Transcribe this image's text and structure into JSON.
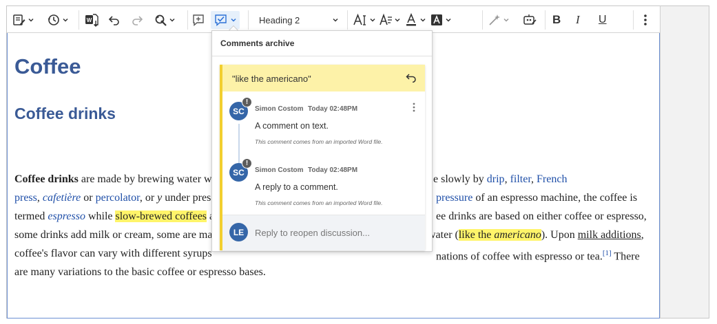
{
  "toolbar": {
    "heading_select": "Heading 2",
    "bold": "B",
    "italic": "I",
    "underline": "U"
  },
  "document": {
    "title": "Coffee",
    "subtitle": "Coffee drinks",
    "lines": {
      "l1_bold": "Coffee drinks",
      "l1_a": " are made by brewing water w",
      "l1_b": "e slowly by ",
      "l1_link1": "drip",
      "l1_c": ", ",
      "l1_link2": "filter",
      "l1_d": ", ",
      "l1_link3": "French",
      "l2_link1": "press",
      "l2_a": ", ",
      "l2_link2": "cafetière",
      "l2_b": " or ",
      "l2_link3": "percolator",
      "l2_c": ", or ",
      "l2_y": "y",
      "l2_d": " under pres",
      "l2_link4": "pressure",
      "l2_e": " of an espresso machine, the coffee is",
      "l3_a": "termed ",
      "l3_link1": "espresso",
      "l3_b": " while ",
      "l3_hl": "slow-brewed coffees",
      "l3_c": " a",
      "l3_d": "ee drinks are based on either coffee or espresso,",
      "l4_a": "some drinks add milk or cream, some are ma",
      "l4_b": "water (",
      "l4_hl1": "like the ",
      "l4_hl2": "americano",
      "l4_c": "). Upon ",
      "l4_ul": "milk additions",
      "l4_d": ",",
      "l5_a": "coffee's flavor can vary with different syrups",
      "l5_b": "nations of coffee with espresso or tea.",
      "l5_sup": "[1]",
      "l5_c": " There",
      "l6_a": "are many variations to the basic coffee or espresso bases."
    }
  },
  "comments_archive": {
    "header": "Comments archive",
    "quote": "\"like the americano\"",
    "comments": [
      {
        "initials": "SC",
        "badge": "!",
        "author": "Simon Costom",
        "time": "Today 02:48PM",
        "text": "A comment on text.",
        "note": "This comment comes from an imported Word file."
      },
      {
        "initials": "SC",
        "badge": "!",
        "author": "Simon Costom",
        "time": "Today 02:48PM",
        "text": "A reply to a comment.",
        "note": "This comment comes from an imported Word file."
      }
    ],
    "reply": {
      "initials": "LE",
      "placeholder": "Reply to reopen discussion..."
    }
  },
  "colors": {
    "heading": "#3a5a96",
    "link": "#1f4fa8",
    "highlight": "#fff46a",
    "thread_accent": "#f2cf2f",
    "avatar": "#3566a8"
  }
}
